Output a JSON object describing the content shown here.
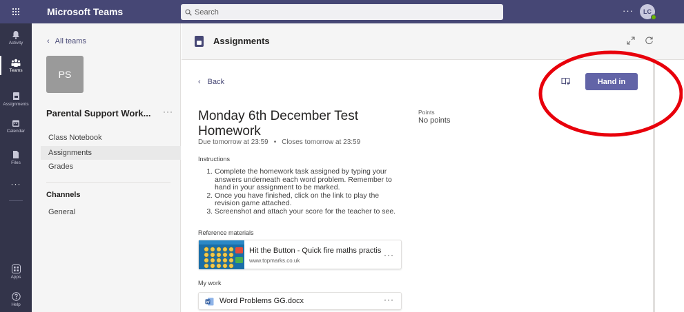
{
  "app": {
    "title": "Microsoft Teams",
    "search_placeholder": "Search",
    "more": "···",
    "avatar_initials": "LC"
  },
  "rail": [
    {
      "label": "Activity",
      "icon": "bell-icon"
    },
    {
      "label": "Teams",
      "icon": "teams-icon"
    },
    {
      "label": "Assignments",
      "icon": "assignments-icon"
    },
    {
      "label": "Calendar",
      "icon": "calendar-icon"
    },
    {
      "label": "Files",
      "icon": "file-icon"
    },
    {
      "label": "···",
      "icon": "more-icon"
    },
    {
      "label": "Apps",
      "icon": "apps-icon"
    },
    {
      "label": "Help",
      "icon": "help-icon"
    }
  ],
  "team_pane": {
    "back_label": "All teams",
    "tile_initials": "PS",
    "team_name": "Parental Support Work...",
    "more": "···",
    "nav": [
      "Class Notebook",
      "Assignments",
      "Grades"
    ],
    "selected_nav": "Assignments",
    "channels_heading": "Channels",
    "channels": [
      "General"
    ]
  },
  "main": {
    "header_title": "Assignments",
    "back_label": "Back",
    "hand_in_label": "Hand in",
    "assignment": {
      "title": "Monday 6th December Test Homework",
      "due": "Due tomorrow at 23:59",
      "separator": "•",
      "closes": "Closes tomorrow at 23:59",
      "points_label": "Points",
      "points_value": "No points",
      "instructions_heading": "Instructions",
      "instructions": [
        "Complete the homework task assigned by typing your answers underneath each word problem. Remember to hand in your assignment to be marked.",
        "Once you have finished, click on the link to play the revision game attached.",
        "Screenshot and attach your score for the teacher to see."
      ],
      "reference_heading": "Reference materials",
      "reference": {
        "title": "Hit the Button - Quick fire maths practis",
        "url": "www.topmarks.co.uk",
        "more": "···"
      },
      "my_work_heading": "My work",
      "work_file": {
        "name": "Word Problems GG.docx",
        "more": "···"
      }
    }
  },
  "colors": {
    "header": "#464775",
    "rail": "#33344a",
    "accent": "#6264a7",
    "annotation": "#e8000b"
  }
}
